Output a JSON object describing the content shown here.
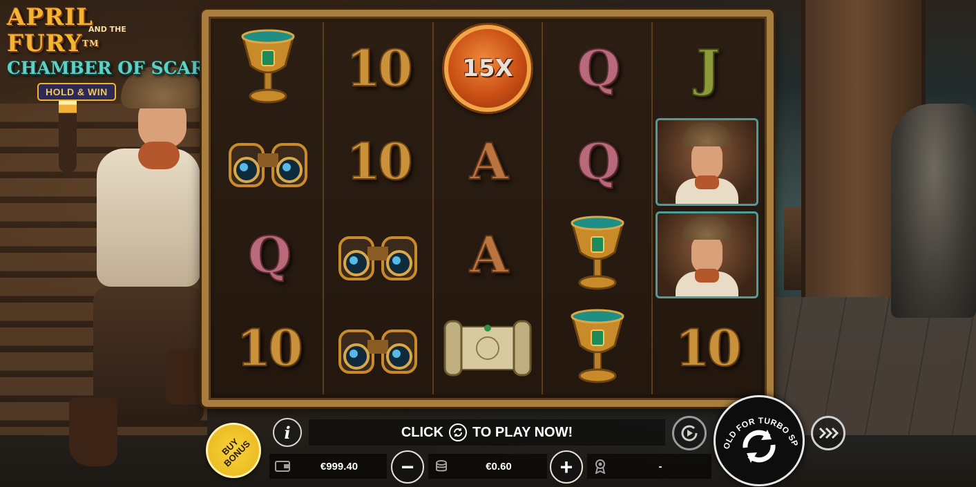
{
  "game": {
    "title_line1": "APRIL FURY",
    "tm": "TM",
    "title_and": "AND THE",
    "title_line2": "CHAMBER OF SCARABS",
    "badge": "HOLD & WIN"
  },
  "reels": [
    [
      {
        "type": "goblet",
        "label": "goblet-icon"
      },
      {
        "type": "binoculars",
        "label": "binoculars-icon"
      },
      {
        "type": "letter",
        "text": "Q",
        "cls": "sym-Q"
      },
      {
        "type": "letter",
        "text": "10",
        "cls": "sym-10"
      }
    ],
    [
      {
        "type": "letter",
        "text": "10",
        "cls": "sym-10"
      },
      {
        "type": "letter",
        "text": "10",
        "cls": "sym-10"
      },
      {
        "type": "binoculars",
        "label": "binoculars-icon"
      },
      {
        "type": "binoculars",
        "label": "binoculars-icon"
      }
    ],
    [
      {
        "type": "coin",
        "text": "15X"
      },
      {
        "type": "letter",
        "text": "A",
        "cls": "sym-A"
      },
      {
        "type": "letter",
        "text": "A",
        "cls": "sym-A"
      },
      {
        "type": "scroll",
        "label": "scroll-icon"
      }
    ],
    [
      {
        "type": "letter",
        "text": "Q",
        "cls": "sym-Q"
      },
      {
        "type": "letter",
        "text": "Q",
        "cls": "sym-Q"
      },
      {
        "type": "goblet",
        "label": "goblet-icon"
      },
      {
        "type": "goblet",
        "label": "goblet-icon"
      }
    ],
    [
      {
        "type": "letter",
        "text": "J",
        "cls": "sym-J"
      },
      {
        "type": "portrait",
        "label": "explorer-portrait"
      },
      {
        "type": "portrait",
        "label": "explorer-portrait"
      },
      {
        "type": "letter",
        "text": "10",
        "cls": "sym-10"
      }
    ]
  ],
  "ui": {
    "buy_bonus": "BUY\nBONUS",
    "info_label": "i",
    "message_before": "CLICK",
    "message_after": "TO PLAY NOW!",
    "balance": "€999.40",
    "bet": "€0.60",
    "win": "-",
    "minus": "−",
    "plus": "+",
    "spin_hint": "HOLD FOR TURBO SPIN"
  },
  "icons": {
    "wallet": "wallet-icon",
    "coins": "coins-stack-icon",
    "win": "win-medal-icon",
    "autoplay": "autoplay-icon",
    "spin": "spin-arrows-icon",
    "turbo": "turbo-icon",
    "refresh": "refresh-icon"
  },
  "colors": {
    "frame_gold": "#a87d3e",
    "buy_bonus_yellow": "#f4c62a",
    "coin_orange": "#d95a1a",
    "logo_gold": "#f2b431",
    "logo_teal": "#5fd0c4"
  }
}
